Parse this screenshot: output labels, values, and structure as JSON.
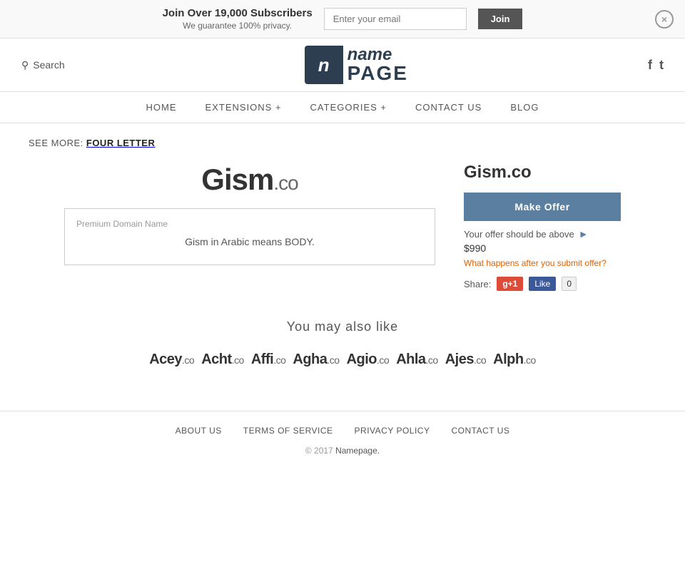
{
  "banner": {
    "main_text": "Join Over 19,000 Subscribers",
    "sub_text": "We guarantee 100% privacy.",
    "email_placeholder": "Enter your email",
    "join_label": "Join",
    "close_label": "×"
  },
  "header": {
    "search_label": "Search",
    "logo_icon": "n",
    "logo_name": "name",
    "logo_page": "PAGE",
    "facebook_label": "f",
    "twitter_label": "t"
  },
  "nav": {
    "items": [
      {
        "label": "HOME"
      },
      {
        "label": "EXTENSIONS +"
      },
      {
        "label": "CATEGORIES +"
      },
      {
        "label": "CONTACT US"
      },
      {
        "label": "BLOG"
      }
    ]
  },
  "breadcrumb": {
    "see_more_label": "See more:",
    "see_more_link": "FOUR LETTER"
  },
  "domain": {
    "name_display": "Gism",
    "tld_display": ".co",
    "info_label": "Premium Domain Name",
    "description": "Gism in Arabic means BODY.",
    "full_name": "Gism.co",
    "make_offer_label": "Make Offer",
    "offer_above_label": "Your offer should be above",
    "offer_price": "$990",
    "what_happens_label": "What happens after you submit offer?",
    "share_label": "Share:",
    "gplus_label": "g+1",
    "fb_label": "Like",
    "fb_count": "0"
  },
  "you_may_like": {
    "heading": "You may also like",
    "domains": [
      {
        "name": "Acey",
        "tld": ".co"
      },
      {
        "name": "Acht",
        "tld": ".co"
      },
      {
        "name": "Affi",
        "tld": ".co"
      },
      {
        "name": "Agha",
        "tld": ".co"
      },
      {
        "name": "Agio",
        "tld": ".co"
      },
      {
        "name": "Ahla",
        "tld": ".co"
      },
      {
        "name": "Ajes",
        "tld": ".co"
      },
      {
        "name": "Alph",
        "tld": ".co"
      }
    ]
  },
  "footer": {
    "links": [
      {
        "label": "ABOUT US"
      },
      {
        "label": "TERMS OF SERVICE"
      },
      {
        "label": "PRIVACY POLICY"
      },
      {
        "label": "CONTACT US"
      }
    ],
    "copy": "© 2017",
    "copy_link": "Namepage.",
    "copy_end": ""
  }
}
